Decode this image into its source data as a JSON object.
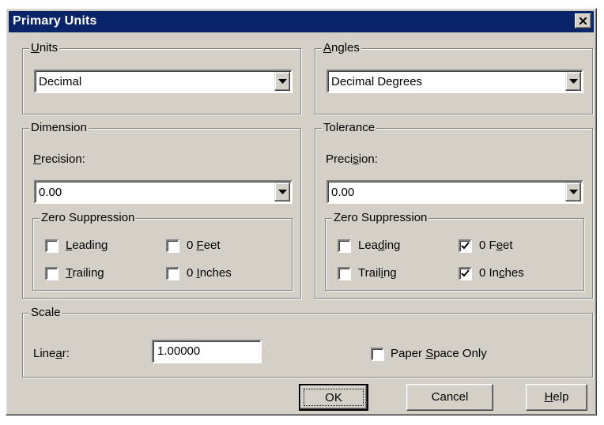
{
  "window": {
    "title": "Primary Units",
    "close_glyph": "✕"
  },
  "units": {
    "group_label_key": "U",
    "group_label_rest": "nits",
    "selected": "Decimal"
  },
  "angles": {
    "group_label_key": "A",
    "group_label_rest": "ngles",
    "selected": "Decimal Degrees"
  },
  "dimension": {
    "group_label": "Dimension",
    "precision_label_key": "P",
    "precision_label_rest": "recision:",
    "precision_value": "0.00",
    "zero_suppression": {
      "group_label": "Zero Suppression",
      "leading": {
        "key": "L",
        "rest": "eading",
        "checked": false
      },
      "trailing": {
        "key": "T",
        "rest": "railing",
        "checked": false
      },
      "feet": {
        "pre": "0 ",
        "key": "F",
        "rest": "eet",
        "checked": false
      },
      "inches": {
        "pre": "0 ",
        "key": "I",
        "rest": "nches",
        "checked": false
      }
    }
  },
  "tolerance": {
    "group_label": "Tolerance",
    "precision_label_pre": "Preci",
    "precision_label_key": "s",
    "precision_label_rest": "ion:",
    "precision_value": "0.00",
    "zero_suppression": {
      "group_label": "Zero Suppression",
      "leading": {
        "pre": "Lea",
        "key": "d",
        "rest": "ing",
        "checked": false
      },
      "trailing": {
        "pre": "Trail",
        "key": "i",
        "rest": "ng",
        "checked": false
      },
      "feet": {
        "pre": "0 F",
        "key": "e",
        "rest": "et",
        "checked": true
      },
      "inches": {
        "pre": "0 In",
        "key": "c",
        "rest": "hes",
        "checked": true
      }
    }
  },
  "scale": {
    "group_label": "Scale",
    "linear_label_pre": "Line",
    "linear_label_key": "a",
    "linear_label_rest": "r:",
    "linear_value": "1.00000",
    "paper_space": {
      "pre": "Paper ",
      "key": "S",
      "rest": "pace Only",
      "checked": false
    }
  },
  "buttons": {
    "ok": "OK",
    "cancel": "Cancel",
    "help_key": "H",
    "help_rest": "elp"
  }
}
